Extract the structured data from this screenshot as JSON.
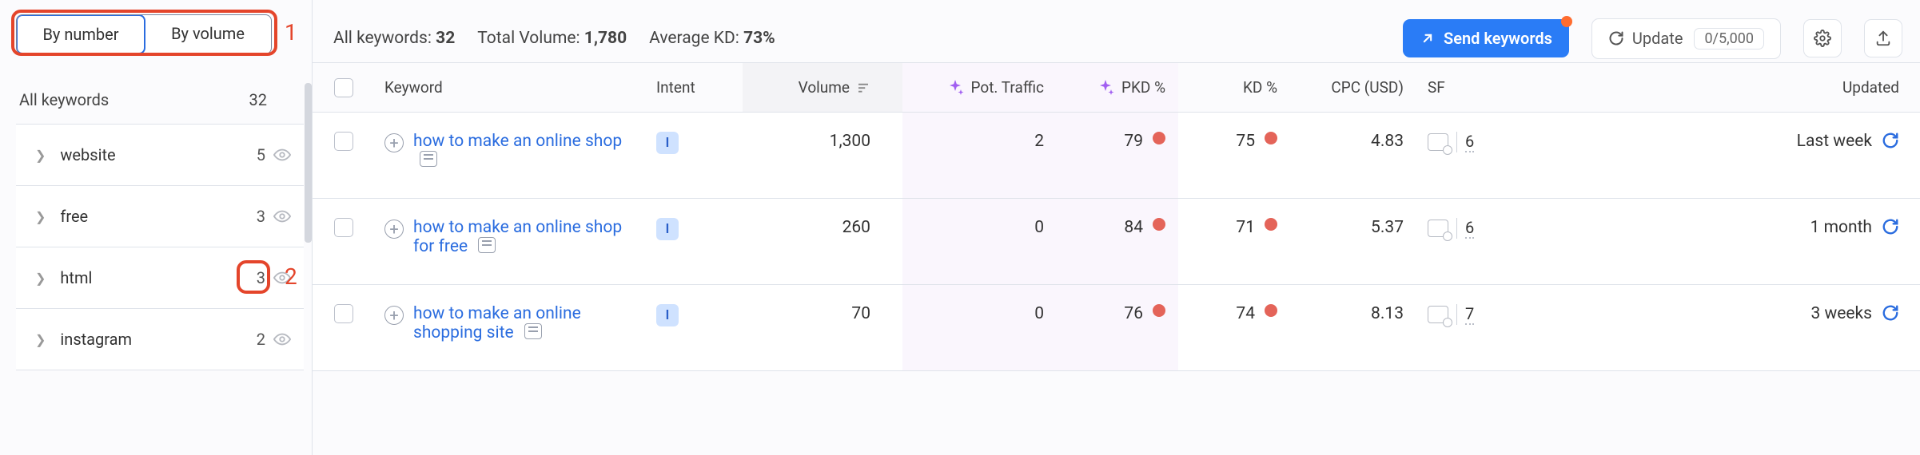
{
  "sidebar": {
    "sort_by_number": "By number",
    "sort_by_volume": "By volume",
    "all_keywords_label": "All keywords",
    "all_keywords_count": "32",
    "groups": [
      {
        "name": "website",
        "count": "5"
      },
      {
        "name": "free",
        "count": "3"
      },
      {
        "name": "html",
        "count": "3"
      },
      {
        "name": "instagram",
        "count": "2"
      }
    ]
  },
  "toolbar": {
    "all_label": "All keywords:",
    "all_value": "32",
    "vol_label": "Total Volume:",
    "vol_value": "1,780",
    "kd_label": "Average KD:",
    "kd_value": "73%",
    "send_label": "Send keywords",
    "update_label": "Update",
    "update_quota": "0/5,000"
  },
  "headers": {
    "keyword": "Keyword",
    "intent": "Intent",
    "volume": "Volume",
    "pot_traffic": "Pot. Traffic",
    "pkd": "PKD %",
    "kd": "KD %",
    "cpc": "CPC (USD)",
    "sf": "SF",
    "updated": "Updated"
  },
  "rows": [
    {
      "keyword": "how to make an online shop",
      "intent": "I",
      "volume": "1,300",
      "pot_traffic": "2",
      "pkd": "79",
      "kd": "75",
      "cpc": "4.83",
      "sf": "6",
      "updated": "Last week"
    },
    {
      "keyword": "how to make an online shop for free",
      "intent": "I",
      "volume": "260",
      "pot_traffic": "0",
      "pkd": "84",
      "kd": "71",
      "cpc": "5.37",
      "sf": "6",
      "updated": "1 month"
    },
    {
      "keyword": "how to make an online shopping site",
      "intent": "I",
      "volume": "70",
      "pot_traffic": "0",
      "pkd": "76",
      "kd": "74",
      "cpc": "8.13",
      "sf": "7",
      "updated": "3 weeks"
    }
  ],
  "annotations": {
    "n1": "1",
    "n2": "2"
  }
}
